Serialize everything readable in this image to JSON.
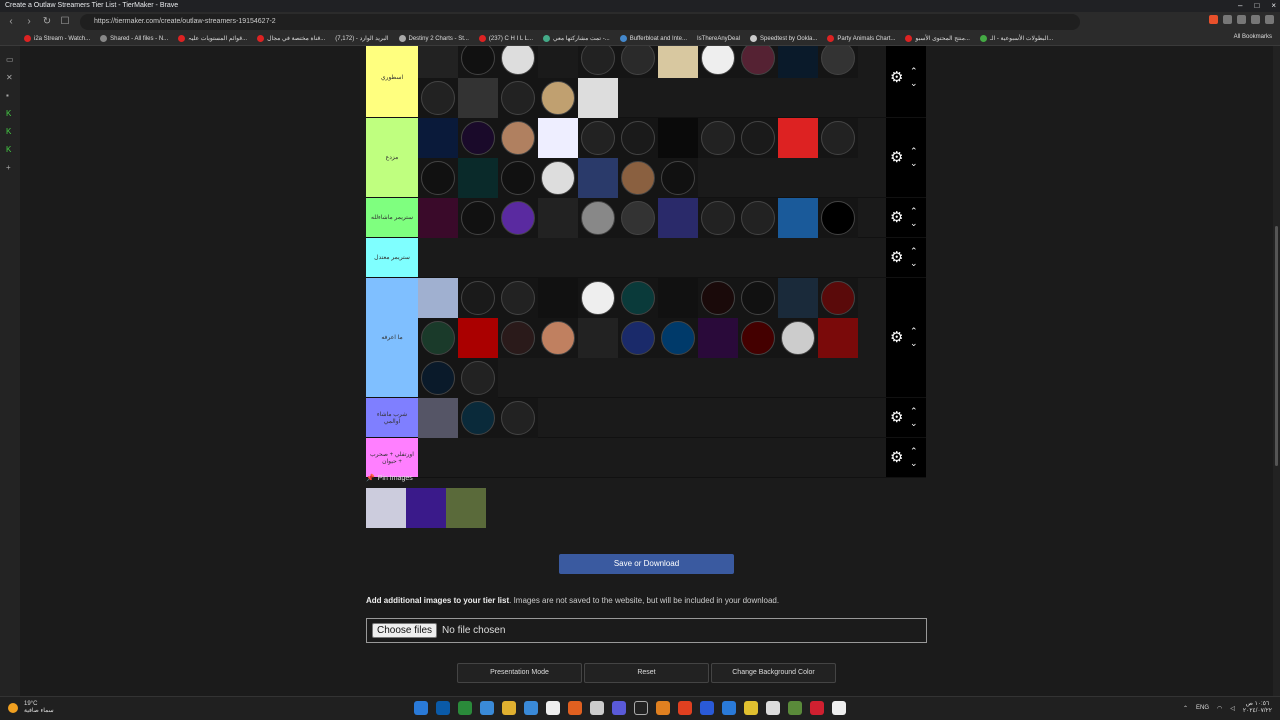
{
  "window": {
    "title": "Create a Outlaw Streamers Tier List - TierMaker - Brave",
    "controls": [
      "–",
      "□",
      "×"
    ]
  },
  "browser": {
    "url": "https://tiermaker.com/create/outlaw-streamers-19154627-2",
    "bookmarks": [
      "i2a Stream - Watch...",
      "Shared - All files - N...",
      "قوائم المستويات علیہ...",
      "قناة مختصة في مجال...",
      "البريد الوارد - (7,172)",
      "Destiny 2 Charts - St...",
      "(237) C H I L L...",
      "تمت مشاركتها معي -...",
      "Bufferbloat and Inte...",
      "IsThereAnyDeal",
      "Speedtest by Ookla...",
      "Party Animals Chart...",
      "منتج المحتوى الأسبو...",
      "البطولات الأسبوعية - الـ..."
    ],
    "all_bookmarks": "All Bookmarks"
  },
  "tiers": [
    {
      "label": "اسطوري",
      "color": "#ffff7f",
      "items": [
        "#222",
        "#111",
        "#ddd",
        "#1a1a1a",
        "#222",
        "#2a2a2a",
        "#d8c8a0",
        "#eee",
        "#552233",
        "#0a1a2a",
        "#333",
        "#222",
        "#333",
        "#222",
        "#c0a070",
        "#ddd"
      ]
    },
    {
      "label": "مزدع",
      "color": "#bfff7f",
      "items": [
        "#0a1a3a",
        "#1a0a2a",
        "#b08060",
        "#eef",
        "#222",
        "#1a1a1a",
        "#0a0a0a",
        "#222",
        "#1a1a1a",
        "#dd2222",
        "#222",
        "#111",
        "#0a2a2a",
        "#111",
        "#ddd",
        "#2a3a6a",
        "#8a6040",
        "#111"
      ]
    },
    {
      "label": "ستريمر ماشاءلله",
      "color": "#7fff7f",
      "items": [
        "#3a0a2a",
        "#111",
        "#5a2aa0",
        "#222",
        "#888",
        "#333",
        "#2a2a6a",
        "#222",
        "#222",
        "#1a5a9a",
        "#000"
      ]
    },
    {
      "label": "ستريمر معتدل",
      "color": "#7fffff",
      "items": []
    },
    {
      "label": "ما اعرفه",
      "color": "#7fbfff",
      "items": [
        "#a0b0d0",
        "#1a1a1a",
        "#222",
        "#111",
        "#eee",
        "#0a3a3a",
        "#111",
        "#1a0a0a",
        "#111",
        "#1a2a3a",
        "#5a0a0a",
        "#1a3a2a",
        "#a00",
        "#2a1a1a",
        "#c08060",
        "#222",
        "#1a2a6a",
        "#003a6a",
        "#2a0a3a",
        "#400",
        "#ccc",
        "#7a0a0a",
        "#0a1a2a",
        "#222"
      ]
    },
    {
      "label": "شرب ماشاء اوالمي",
      "color": "#7f7fff",
      "items": [
        "#556",
        "#0a2a3a",
        "#222"
      ]
    },
    {
      "label": "اورتفلي + صحرب + حيوان",
      "color": "#ff7fff",
      "items": []
    }
  ],
  "pin": {
    "title": "Pin Images",
    "items": [
      "#ccd",
      "#3a1a8a",
      "#5a6a3a"
    ]
  },
  "save_label": "Save or Download",
  "add_images": {
    "bold": "Add additional images to your tier list",
    "rest": ". Images are not saved to the website, but will be included in your download."
  },
  "file_input": {
    "button": "Choose files",
    "status": "No file chosen"
  },
  "buttons": {
    "presentation": "Presentation Mode",
    "reset": "Reset",
    "bg": "Change Background Color"
  },
  "taskbar": {
    "temp": "19°C",
    "weather": "سماء صافية",
    "lang": "ENG",
    "time": "١٠:٥٦ ص",
    "date": "٢٠٢٤/٠٧/٢٢"
  },
  "colors": {
    "save": "#3a5aa0",
    "control": "#000000"
  }
}
